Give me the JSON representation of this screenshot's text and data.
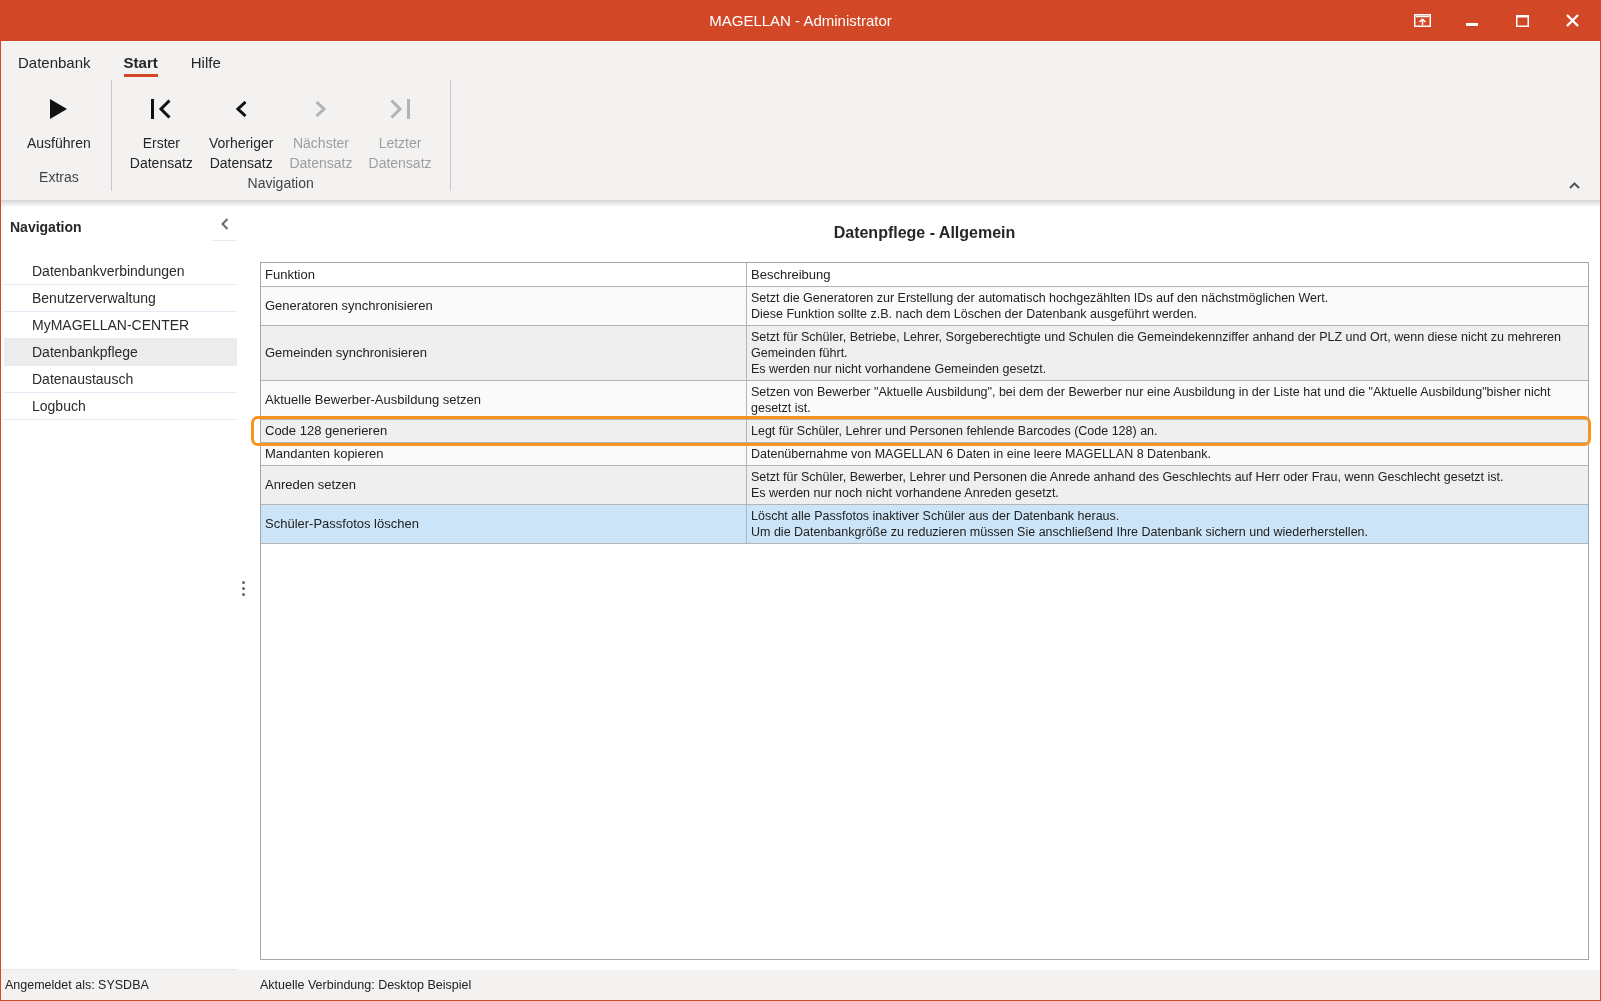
{
  "window": {
    "title": "MAGELLAN - Administrator"
  },
  "ribbon": {
    "tabs": [
      {
        "label": "Datenbank",
        "selected": false
      },
      {
        "label": "Start",
        "selected": true
      },
      {
        "label": "Hilfe",
        "selected": false
      }
    ],
    "groups": [
      {
        "label": "Extras",
        "buttons": [
          {
            "kind": "run",
            "label": "Ausführen",
            "disabled": false
          }
        ]
      },
      {
        "label": "Navigation",
        "buttons": [
          {
            "kind": "first",
            "label": "Erster\nDatensatz",
            "disabled": false
          },
          {
            "kind": "prev",
            "label": "Vorheriger\nDatensatz",
            "disabled": false
          },
          {
            "kind": "next",
            "label": "Nächster\nDatensatz",
            "disabled": true
          },
          {
            "kind": "last",
            "label": "Letzter\nDatensatz",
            "disabled": true
          }
        ]
      }
    ]
  },
  "navigation": {
    "title": "Navigation",
    "items": [
      {
        "label": "Datenbankverbindungen",
        "selected": false
      },
      {
        "label": "Benutzerverwaltung",
        "selected": false
      },
      {
        "label": "MyMAGELLAN-CENTER",
        "selected": false
      },
      {
        "label": "Datenbankpflege",
        "selected": true
      },
      {
        "label": "Datenaustausch",
        "selected": false
      },
      {
        "label": "Logbuch",
        "selected": false
      }
    ]
  },
  "content": {
    "title": "Datenpflege - Allgemein",
    "columns": [
      "Funktion",
      "Beschreibung"
    ],
    "rows": [
      {
        "function": "Generatoren synchronisieren",
        "description": "Setzt die Generatoren zur Erstellung der automatisch hochgezählten IDs auf den nächstmöglichen Wert.\nDiese Funktion sollte z.B. nach dem Löschen der Datenbank ausgeführt werden.",
        "selected": false,
        "highlighted": false
      },
      {
        "function": "Gemeinden synchronisieren",
        "description": "Setzt für Schüler, Betriebe, Lehrer, Sorgeberechtigte und Schulen die Gemeindekennziffer anhand der PLZ und Ort, wenn diese nicht zu mehreren\nGemeinden führt.\nEs werden nur nicht vorhandene Gemeinden gesetzt.",
        "selected": false,
        "highlighted": false
      },
      {
        "function": "Aktuelle Bewerber-Ausbildung setzen",
        "description": "Setzen von Bewerber \"Aktuelle Ausbildung\", bei dem der Bewerber nur eine Ausbildung in der Liste hat und die \"Aktuelle Ausbildung\"bisher nicht\ngesetzt ist.",
        "selected": false,
        "highlighted": false
      },
      {
        "function": "Code 128 generieren",
        "description": "Legt für Schüler, Lehrer und Personen fehlende Barcodes (Code 128) an.",
        "selected": false,
        "highlighted": true
      },
      {
        "function": "Mandanten kopieren",
        "description": "Datenübernahme von MAGELLAN 6 Daten in eine leere MAGELLAN 8 Datenbank.",
        "selected": false,
        "highlighted": false
      },
      {
        "function": "Anreden setzen",
        "description": "Setzt für Schüler, Bewerber, Lehrer und Personen die Anrede anhand des Geschlechts auf Herr oder Frau, wenn Geschlecht gesetzt ist.\nEs werden nur noch nicht vorhandene Anreden gesetzt.",
        "selected": false,
        "highlighted": false
      },
      {
        "function": "Schüler-Passfotos löschen",
        "description": "Löscht alle Passfotos inaktiver Schüler aus der Datenbank heraus.\nUm die Datenbankgröße zu reduzieren müssen Sie anschließend Ihre Datenbank sichern und wiederherstellen.",
        "selected": true,
        "highlighted": false
      }
    ]
  },
  "status_bar": {
    "user": "Angemeldet als: SYSDBA",
    "connection": "Aktuelle Verbindung: Desktop Beispiel"
  }
}
